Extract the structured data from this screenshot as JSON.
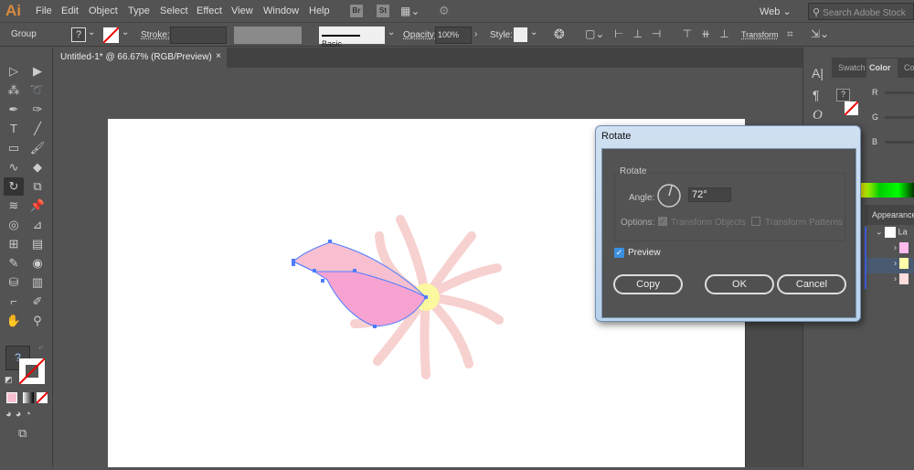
{
  "app": {
    "logo": "Ai",
    "menus": [
      "File",
      "Edit",
      "Object",
      "Type",
      "Select",
      "Effect",
      "View",
      "Window",
      "Help"
    ],
    "bridge": "Br",
    "stock": "St",
    "workspace": "Web",
    "search_placeholder": "Search Adobe Stock"
  },
  "control": {
    "selection": "Group",
    "stroke_label": "Stroke:",
    "brush": "Basic",
    "opacity_label": "Opacity:",
    "opacity": "100%",
    "style_label": "Style:",
    "transform": "Transform",
    "fill_unknown": "?"
  },
  "document": {
    "tab": "Untitled-1* @ 66.67% (RGB/Preview)",
    "close": "×"
  },
  "tools": {
    "fill_unknown": "?"
  },
  "right_strip": {
    "char": "A|",
    "para": "¶",
    "opentype": "O"
  },
  "color_panel": {
    "tabs": [
      "Swatch",
      "Color",
      "Co"
    ],
    "channels": [
      "R",
      "G",
      "B"
    ],
    "fill_unknown": "?"
  },
  "appearance": {
    "tab": "Appearance",
    "layer": "La"
  },
  "dialog": {
    "title": "Rotate",
    "group": "Rotate",
    "angle_label": "Angle:",
    "angle": "72°",
    "options_label": "Options:",
    "transform_objects": "Transform Objects",
    "transform_patterns": "Transform Patterns",
    "preview": "Preview",
    "preview_checked": true,
    "transform_objects_checked": true,
    "transform_patterns_checked": false,
    "copy": "Copy",
    "ok": "OK",
    "cancel": "Cancel"
  },
  "colors": {
    "accent": "#d98a3e",
    "petal": "#f6a3d2",
    "petal_light": "#f7bfd0",
    "ray": "#f7d0d0",
    "center": "#fbf8a0",
    "selection": "#4f7cff"
  }
}
